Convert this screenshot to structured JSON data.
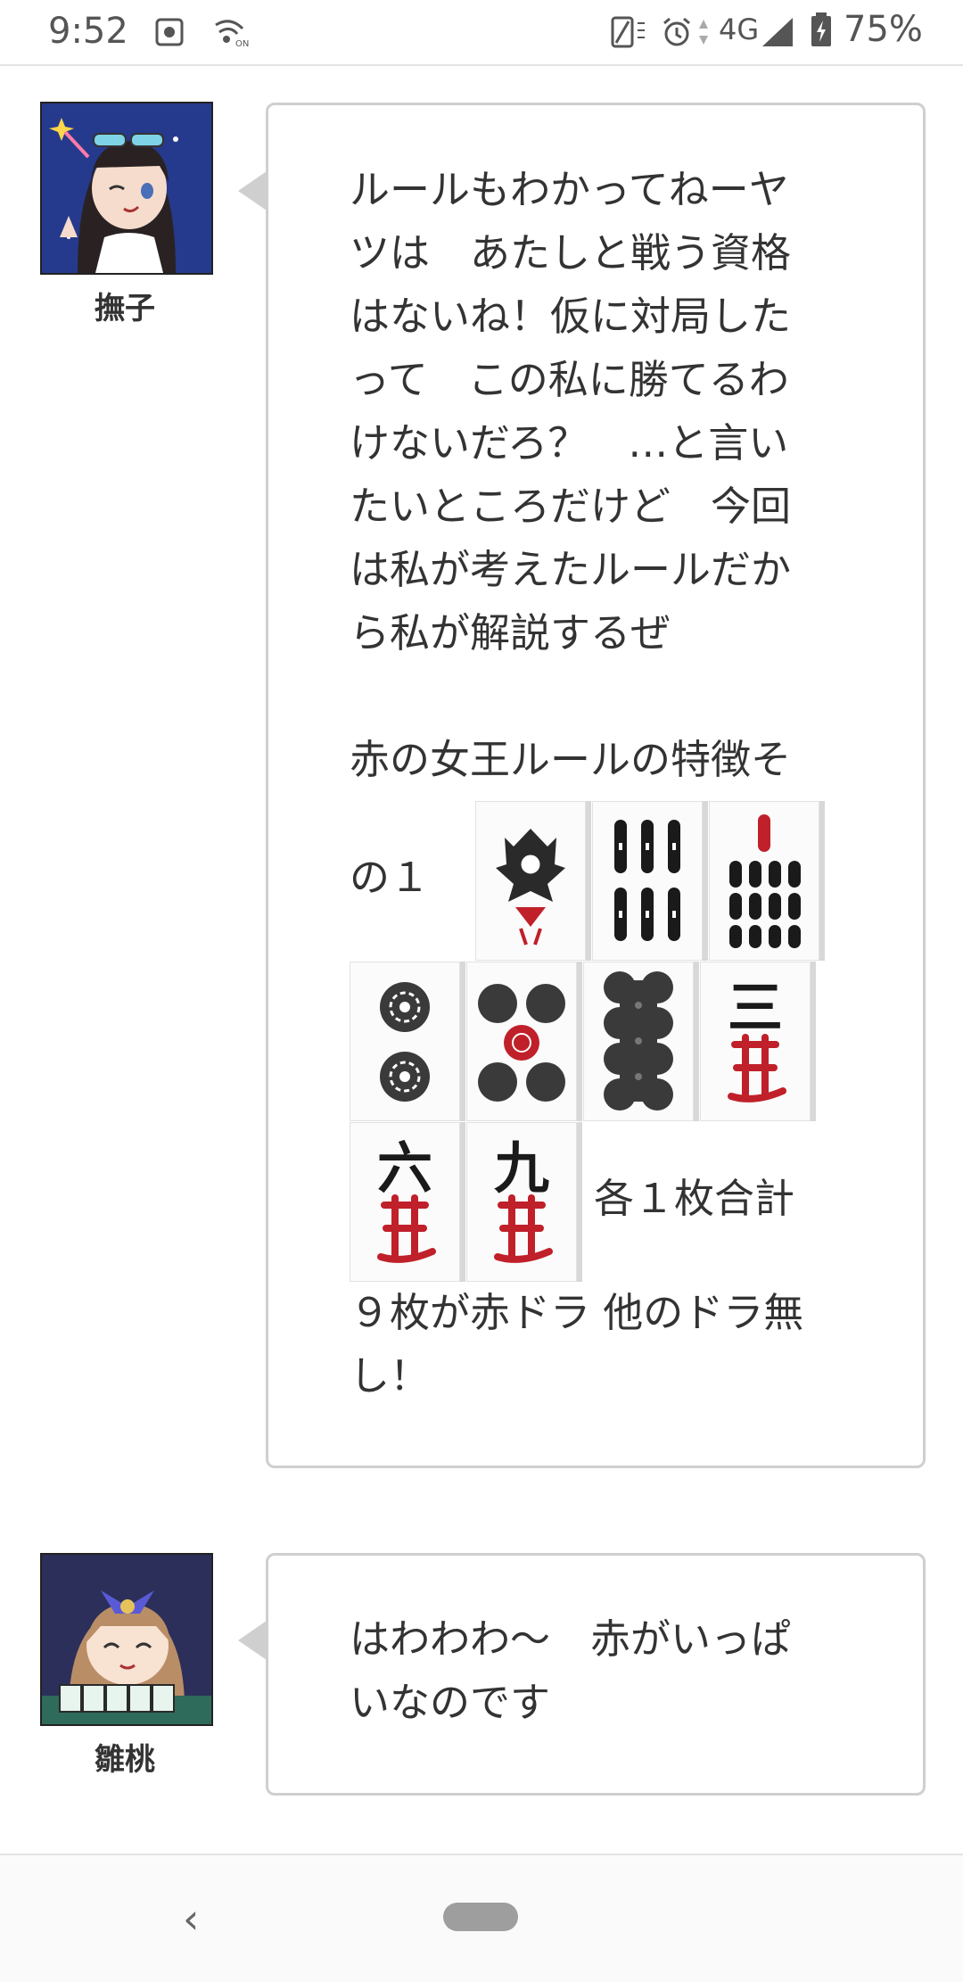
{
  "status_bar": {
    "time": "9:52",
    "network": "4G",
    "battery": "75%",
    "icons": [
      "settings-icon",
      "nfc-on-icon",
      "vibrate-icon",
      "alarm-icon",
      "signal-icon",
      "battery-charging-icon"
    ]
  },
  "messages": [
    {
      "name": "撫子",
      "lines": [
        "ルールもわかってねーヤ",
        "ツは　あたしと戦う資格",
        "はないね！仮に対局した",
        "って　この私に勝てるわ",
        "けないだろ？　…と言い",
        "たいところだけど　今回",
        "は私が考えたルールだか",
        "ら私が解説するぜ",
        "",
        "赤の女王ルールの特徴そ"
      ],
      "tile_row1_prefix": "の１",
      "tile_row3_suffix": "各１枚合計",
      "after_lines": [
        "９枚が赤ドラ 他のドラ無",
        "し！"
      ],
      "tiles": [
        {
          "name": "一索 (bird)",
          "glyph": ""
        },
        {
          "name": "六索",
          "glyph": ""
        },
        {
          "name": "九索",
          "glyph": ""
        },
        {
          "name": "二筒",
          "glyph": ""
        },
        {
          "name": "五筒",
          "glyph": ""
        },
        {
          "name": "八筒",
          "glyph": ""
        },
        {
          "name": "三萬",
          "glyph": "三"
        },
        {
          "name": "六萬",
          "glyph": "六"
        },
        {
          "name": "九萬",
          "glyph": "九"
        }
      ]
    },
    {
      "name": "雛桃",
      "lines": [
        "はわわわ〜　赤がいっぱ",
        "いなのです"
      ]
    }
  ],
  "nav": {
    "back": "‹"
  },
  "colors": {
    "tile_red": "#c0202a",
    "tile_black": "#1a1a1a",
    "bubble_border": "#cfcfcf"
  }
}
